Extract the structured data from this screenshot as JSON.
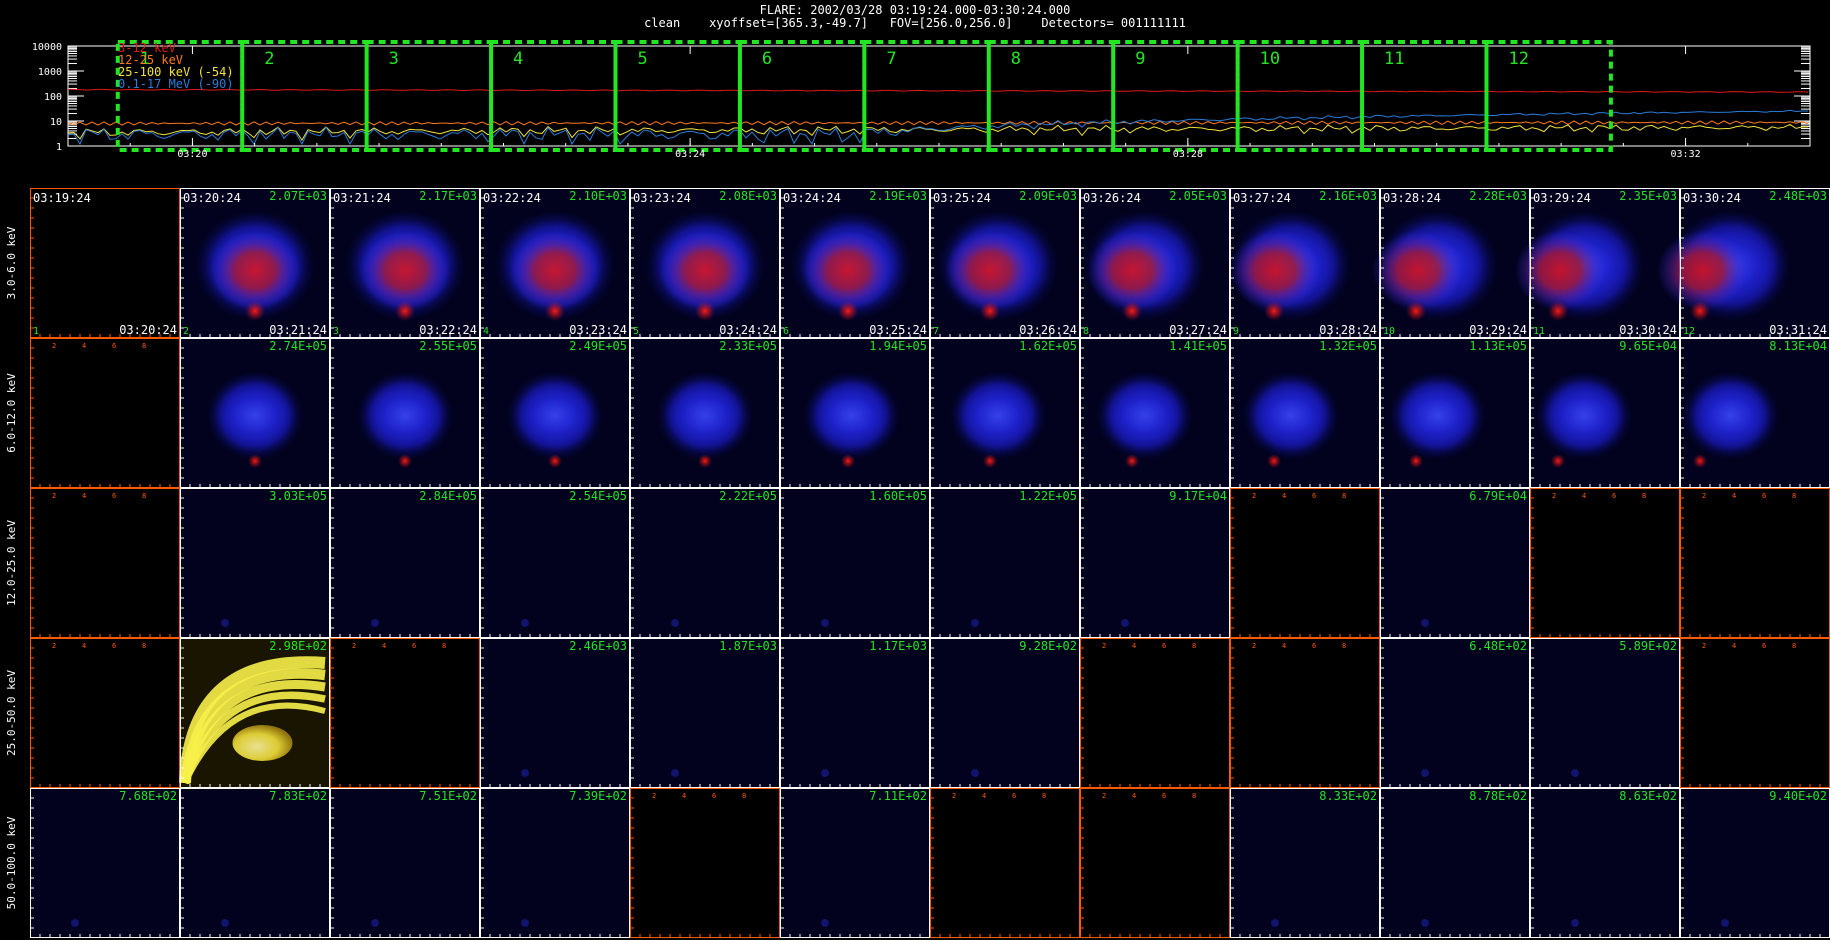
{
  "header": {
    "title": "FLARE: 2002/03/28 03:19:24.000-03:30:24.000",
    "subtitle": "clean    xyoffset=[365.3,-49.7]   FOV=[256.0,256.0]    Detectors= 001111111"
  },
  "lightcurve": {
    "y_ticks": [
      "10000",
      "1000",
      "100",
      "10",
      "1"
    ],
    "time_ticks": [
      "03:20",
      "03:24",
      "03:28",
      "03:32"
    ],
    "legend": [
      {
        "label": "3-12 keV",
        "color": "#e01818"
      },
      {
        "label": "12-25 keV",
        "color": "#ff7a1a"
      },
      {
        "label": "25-100 keV (-54)",
        "color": "#f2e23a"
      },
      {
        "label": "0.1-17 MeV (-90)",
        "color": "#2a7ddc"
      }
    ],
    "intervals": [
      "1",
      "2",
      "3",
      "4",
      "5",
      "6",
      "7",
      "8",
      "9",
      "10",
      "11",
      "12"
    ],
    "interval_color": "#22e622"
  },
  "energy_bands": [
    "3.0-6.0 keV",
    "6.0-12.0 keV",
    "12.0-25.0 keV",
    "25.0-50.0 keV",
    "50.0-100.0 keV"
  ],
  "start_times": [
    "03:19:24",
    "03:20:24",
    "03:21:24",
    "03:22:24",
    "03:23:24",
    "03:24:24",
    "03:25:24",
    "03:26:24",
    "03:27:24",
    "03:28:24",
    "03:29:24",
    "03:30:24"
  ],
  "end_times": [
    "03:20:24",
    "03:21:24",
    "03:22:24",
    "03:23:24",
    "03:24:24",
    "03:25:24",
    "03:26:24",
    "03:27:24",
    "03:28:24",
    "03:29:24",
    "03:30:24",
    "03:31:24"
  ],
  "interval_numbers": [
    "1",
    "2",
    "3",
    "4",
    "5",
    "6",
    "7",
    "8",
    "9",
    "10",
    "11",
    "12"
  ],
  "peak_values": [
    [
      "",
      "2.07E+03",
      "2.17E+03",
      "2.10E+03",
      "2.08E+03",
      "2.19E+03",
      "2.09E+03",
      "2.05E+03",
      "2.16E+03",
      "2.28E+03",
      "2.35E+03",
      "2.48E+03"
    ],
    [
      "",
      "2.74E+05",
      "2.55E+05",
      "2.49E+05",
      "2.33E+05",
      "1.94E+05",
      "1.62E+05",
      "1.41E+05",
      "1.32E+05",
      "1.13E+05",
      "9.65E+04",
      "8.13E+04"
    ],
    [
      "",
      "3.03E+05",
      "2.84E+05",
      "2.54E+05",
      "2.22E+05",
      "1.60E+05",
      "1.22E+05",
      "9.17E+04",
      "",
      "6.79E+04",
      "",
      ""
    ],
    [
      "",
      "2.98E+02",
      "",
      "2.46E+03",
      "1.87E+03",
      "1.17E+03",
      "9.28E+02",
      "",
      "",
      "6.48E+02",
      "5.89E+02",
      ""
    ],
    [
      "7.68E+02",
      "7.83E+02",
      "7.51E+02",
      "7.39E+02",
      "",
      "7.11E+02",
      "",
      "",
      "8.33E+02",
      "8.78E+02",
      "8.63E+02",
      "9.40E+02"
    ]
  ],
  "cell_kinds": [
    [
      "empty",
      "source",
      "source",
      "source",
      "source",
      "source",
      "source",
      "source",
      "source",
      "source",
      "source",
      "source"
    ],
    [
      "empty",
      "source",
      "source",
      "source",
      "source",
      "source",
      "source",
      "source",
      "source",
      "source",
      "source",
      "source"
    ],
    [
      "empty",
      "faint",
      "faint",
      "faint",
      "faint",
      "faint",
      "faint",
      "faint",
      "empty",
      "faint",
      "empty",
      "empty"
    ],
    [
      "empty",
      "yellow",
      "empty",
      "faint",
      "faint",
      "faint",
      "faint",
      "empty",
      "empty",
      "faint",
      "faint",
      "empty"
    ],
    [
      "faint",
      "faint",
      "faint",
      "faint",
      "empty",
      "faint",
      "empty",
      "empty",
      "faint",
      "faint",
      "faint",
      "faint"
    ]
  ],
  "axis_tick_labels": [
    "2",
    "4",
    "6",
    "8"
  ],
  "colors": {
    "peak_text": "#22e622",
    "axis": "#ff5a00",
    "blue": "#1a22ff",
    "red": "#d01010",
    "yellow": "#f7ef4a",
    "dark_navy": "#02021f"
  }
}
